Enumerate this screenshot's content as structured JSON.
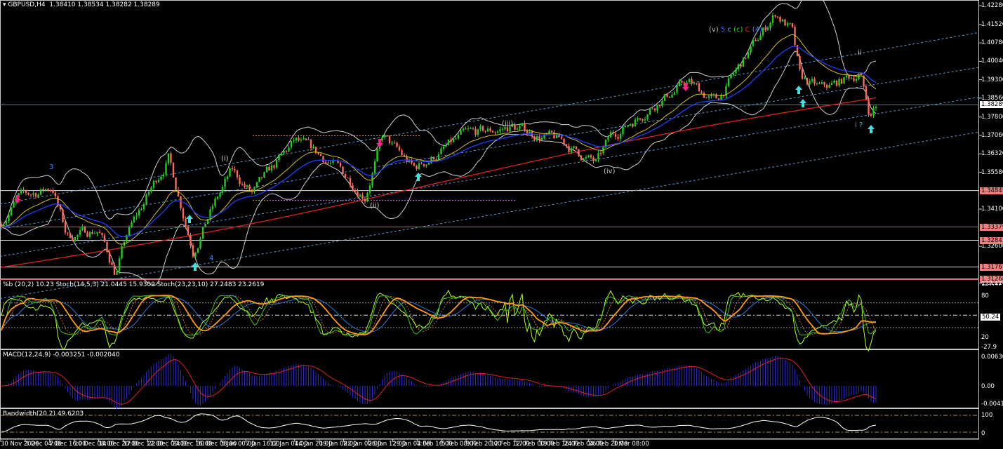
{
  "header": {
    "symbol": "GBPUSD,H4",
    "ohlc": "1.38410 1.38534 1.38282 1.38289"
  },
  "price_axis": [
    "1.42280",
    "1.41520",
    "1.40780",
    "1.40040",
    "1.39300",
    "1.38560",
    "1.37800",
    "1.37060",
    "1.36320",
    "1.35580",
    "1.34100",
    "1.32600",
    "1.31120"
  ],
  "current_price": "1.38289",
  "levels": [
    {
      "label": "1.34845",
      "color": "#ffffff"
    },
    {
      "label": "1.33379",
      "color": "#f08080"
    },
    {
      "label": "1.32843",
      "color": "#ffffff"
    },
    {
      "label": "1.31767",
      "color": "#ffffff"
    },
    {
      "label": "1.31268",
      "color": "#f08080"
    }
  ],
  "stoch": {
    "label": "%b (20,2) 10.23  Stoch(14,5,3) 21.0445 15.9309  Stoch(23,23,10) 27.2483 23.2619",
    "max": "127.47",
    "level80": "80",
    "mid": "50.24",
    "level20": "20",
    "min": "-27.9"
  },
  "macd": {
    "label": "MACD(12,24,9) -0.003251 -0.002040",
    "max": "0.006301",
    "zero": "0.00",
    "min": "-0.004121"
  },
  "bandwidth": {
    "label": "Bandwidth(20,2) 49.6203",
    "max": "100",
    "min": "0"
  },
  "time_axis": [
    "30 Nov 2020",
    "3 Dec 04:00",
    "7 Dec 16:00",
    "10 Dec 08:00",
    "14 Dec 20:00",
    "17 Dec 12:00",
    "22 Dec 00:00",
    "24 Dec 16:00",
    "30 Dec 08:00",
    "5 Jan 00:00",
    "7 Jan 16:00",
    "12 Jan 04:00",
    "14 Jan 20:00",
    "19 Jan 08:00",
    "22 Jan 00:00",
    "26 Jan 12:00",
    "29 Jan 04:00",
    "2 Feb 16:00",
    "5 Feb 08:00",
    "9 Feb 20:00",
    "12 Feb 12:00",
    "17 Feb 00:00",
    "19 Feb 16:00",
    "24 Feb 04:00",
    "26 Feb 20:00",
    "3 Mar 08:00"
  ],
  "wave_labels": {
    "w3": "3",
    "w4": "4",
    "wi": "(i)",
    "wii": "(ii)",
    "wiii": "(iii)",
    "wiv": "(iv)",
    "ii": "ii",
    "i_q": "i ?",
    "top": [
      {
        "t": "(v)",
        "c": "#c0c0c0"
      },
      {
        "t": "5",
        "c": "#4060ff"
      },
      {
        "t": "c",
        "c": "#40c0c0"
      },
      {
        "t": "(c)",
        "c": "#30c030"
      },
      {
        "t": "C",
        "c": "#e02020"
      },
      {
        "t": "(4)",
        "c": "#5080ff"
      },
      {
        "t": "?",
        "c": "#5080ff"
      }
    ]
  },
  "colors": {
    "bull": "#22cc22",
    "bear": "#ff6a5a",
    "sma200": "#e02020",
    "ema_blue": "#1e40ff",
    "ema_yellow": "#d4c020",
    "bands": "#d0d0d0",
    "up_arrow": "#40e0e0",
    "down_arrow": "#ff2090"
  }
}
